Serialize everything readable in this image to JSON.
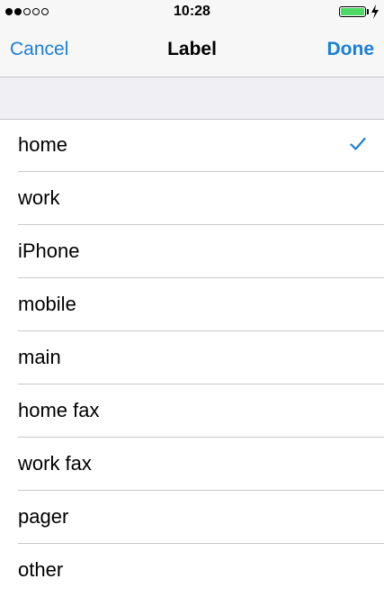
{
  "status_bar": {
    "time": "10:28",
    "signal_dots_filled": 2,
    "signal_dots_total": 5,
    "battery_level": 1.0,
    "battery_color": "#4cd964",
    "charging_icon": "lightning-bolt-icon"
  },
  "nav": {
    "cancel_label": "Cancel",
    "title": "Label",
    "done_label": "Done",
    "accent_color": "#1a7fd8"
  },
  "list": {
    "items": [
      {
        "label": "home",
        "selected": true
      },
      {
        "label": "work",
        "selected": false
      },
      {
        "label": "iPhone",
        "selected": false
      },
      {
        "label": "mobile",
        "selected": false
      },
      {
        "label": "main",
        "selected": false
      },
      {
        "label": "home fax",
        "selected": false
      },
      {
        "label": "work fax",
        "selected": false
      },
      {
        "label": "pager",
        "selected": false
      },
      {
        "label": "other",
        "selected": false
      }
    ],
    "checkmark_icon": "checkmark-icon"
  }
}
